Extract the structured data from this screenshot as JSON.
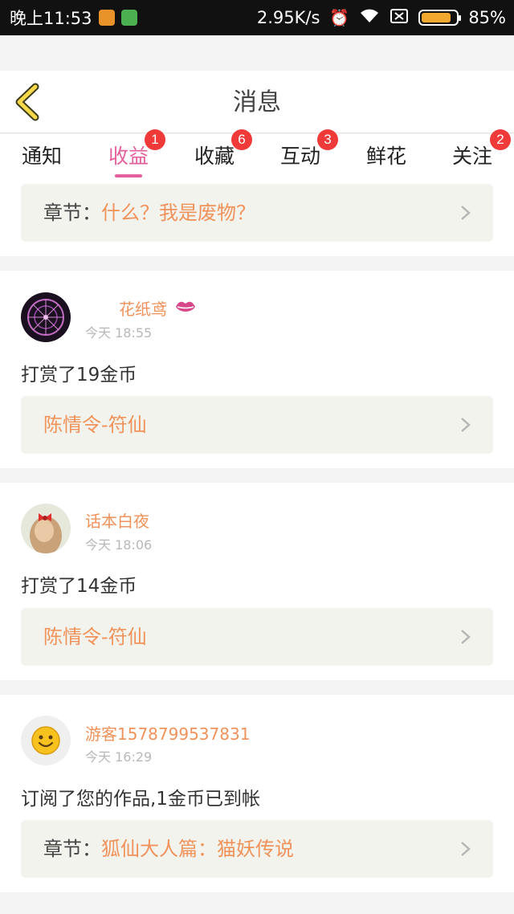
{
  "status_bar": {
    "time": "晚上11:53",
    "speed": "2.95K/s",
    "battery": "85%",
    "battery_level": 0.85
  },
  "header": {
    "title": "消息"
  },
  "tabs": [
    {
      "label": "通知",
      "badge": ""
    },
    {
      "label": "收益",
      "badge": "1",
      "active": true
    },
    {
      "label": "收藏",
      "badge": "6"
    },
    {
      "label": "互动",
      "badge": "3"
    },
    {
      "label": "鲜花",
      "badge": ""
    },
    {
      "label": "关注",
      "badge": "2"
    }
  ],
  "top_link": {
    "label": "章节：",
    "value": "什么？我是废物？"
  },
  "messages": [
    {
      "username": "花纸鸢",
      "time": "今天 18:55",
      "action": "打赏了19金币",
      "link_value": "陈情令-符仙"
    },
    {
      "username": "话本白夜",
      "time": "今天 18:06",
      "action": "打赏了14金币",
      "link_value": "陈情令-符仙"
    },
    {
      "username": "游客1578799537831",
      "time": "今天 16:29",
      "action": "订阅了您的作品,1金币已到帐",
      "link_label": "章节：",
      "link_value": "狐仙大人篇：猫妖传说"
    }
  ],
  "colors": {
    "accent_pink": "#e4609c",
    "accent_orange": "#f0925a",
    "badge_red": "#f03a3a",
    "link_bg": "#f3f3ee"
  }
}
